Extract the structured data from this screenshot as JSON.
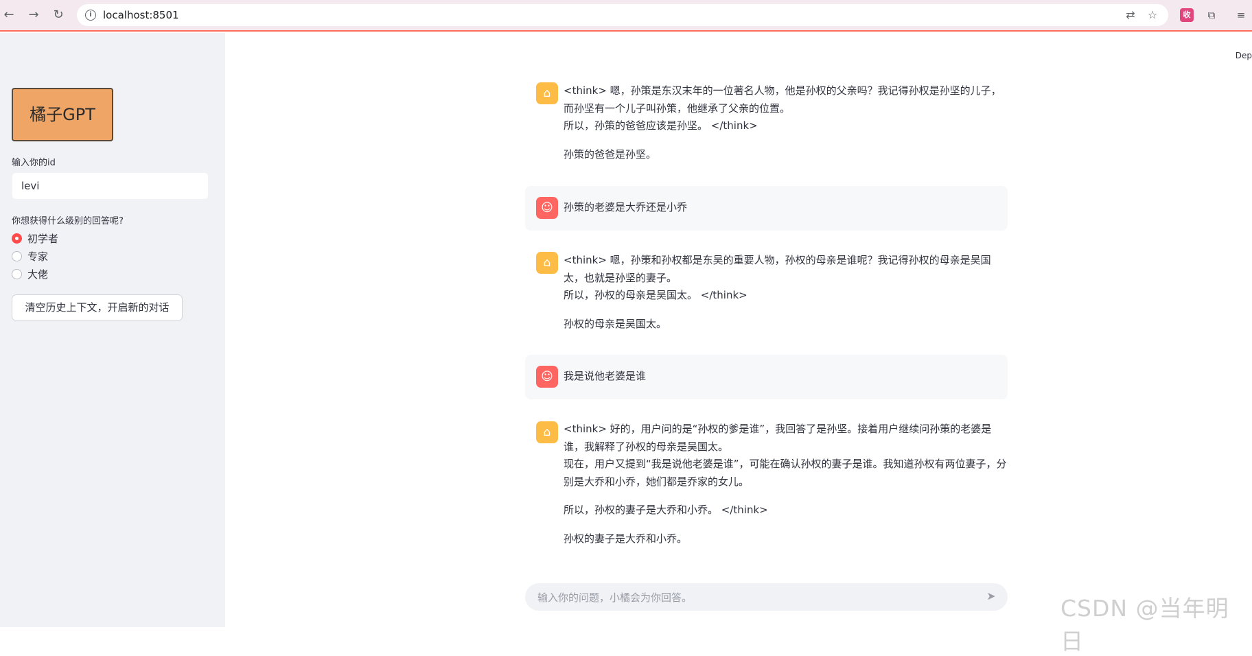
{
  "browser": {
    "url": "localhost:8501",
    "ext_badge": "收"
  },
  "sidebar": {
    "logo_label": "橘子GPT",
    "id_label": "输入你的id",
    "id_value": "levi",
    "level_label": "你想获得什么级别的回答呢?",
    "level_options": [
      "初学者",
      "专家",
      "大佬"
    ],
    "level_selected": "初学者",
    "clear_button": "清空历史上下文，开启新的对话"
  },
  "main": {
    "deploy_label": "Dep",
    "messages": [
      {
        "role": "assistant",
        "lines": [
          "<think> 嗯，孙策是东汉末年的一位著名人物，他是孙权的父亲吗？我记得孙权是孙坚的儿子，而孙坚有一个儿子叫孙策，他继承了父亲的位置。",
          "所以，孙策的爸爸应该是孙坚。 </think>",
          "孙策的爸爸是孙坚。"
        ]
      },
      {
        "role": "user",
        "lines": [
          "孙策的老婆是大乔还是小乔"
        ]
      },
      {
        "role": "assistant",
        "lines": [
          "<think> 嗯，孙策和孙权都是东吴的重要人物，孙权的母亲是谁呢？我记得孙权的母亲是吴国太，也就是孙坚的妻子。",
          "所以，孙权的母亲是吴国太。 </think>",
          "孙权的母亲是吴国太。"
        ]
      },
      {
        "role": "user",
        "lines": [
          "我是说他老婆是谁"
        ]
      },
      {
        "role": "assistant",
        "lines": [
          "<think> 好的，用户问的是“孙权的爹是谁”，我回答了是孙坚。接着用户继续问孙策的老婆是谁，我解释了孙权的母亲是吴国太。",
          "现在，用户又提到“我是说他老婆是谁”，可能在确认孙权的妻子是谁。我知道孙权有两位妻子，分别是大乔和小乔，她们都是乔家的女儿。",
          "所以，孙权的妻子是大乔和小乔。 </think>",
          "孙权的妻子是大乔和小乔。"
        ]
      }
    ],
    "chat_placeholder": "输入你的问题，小橘会为你回答。"
  },
  "watermark": "CSDN @当年明日",
  "colors": {
    "accent": "#ff4b4b",
    "bot_avatar": "#fcbc45",
    "user_avatar": "#ff6662",
    "logo_button": "#eea566",
    "sidebar_bg": "#f0f2f6"
  }
}
